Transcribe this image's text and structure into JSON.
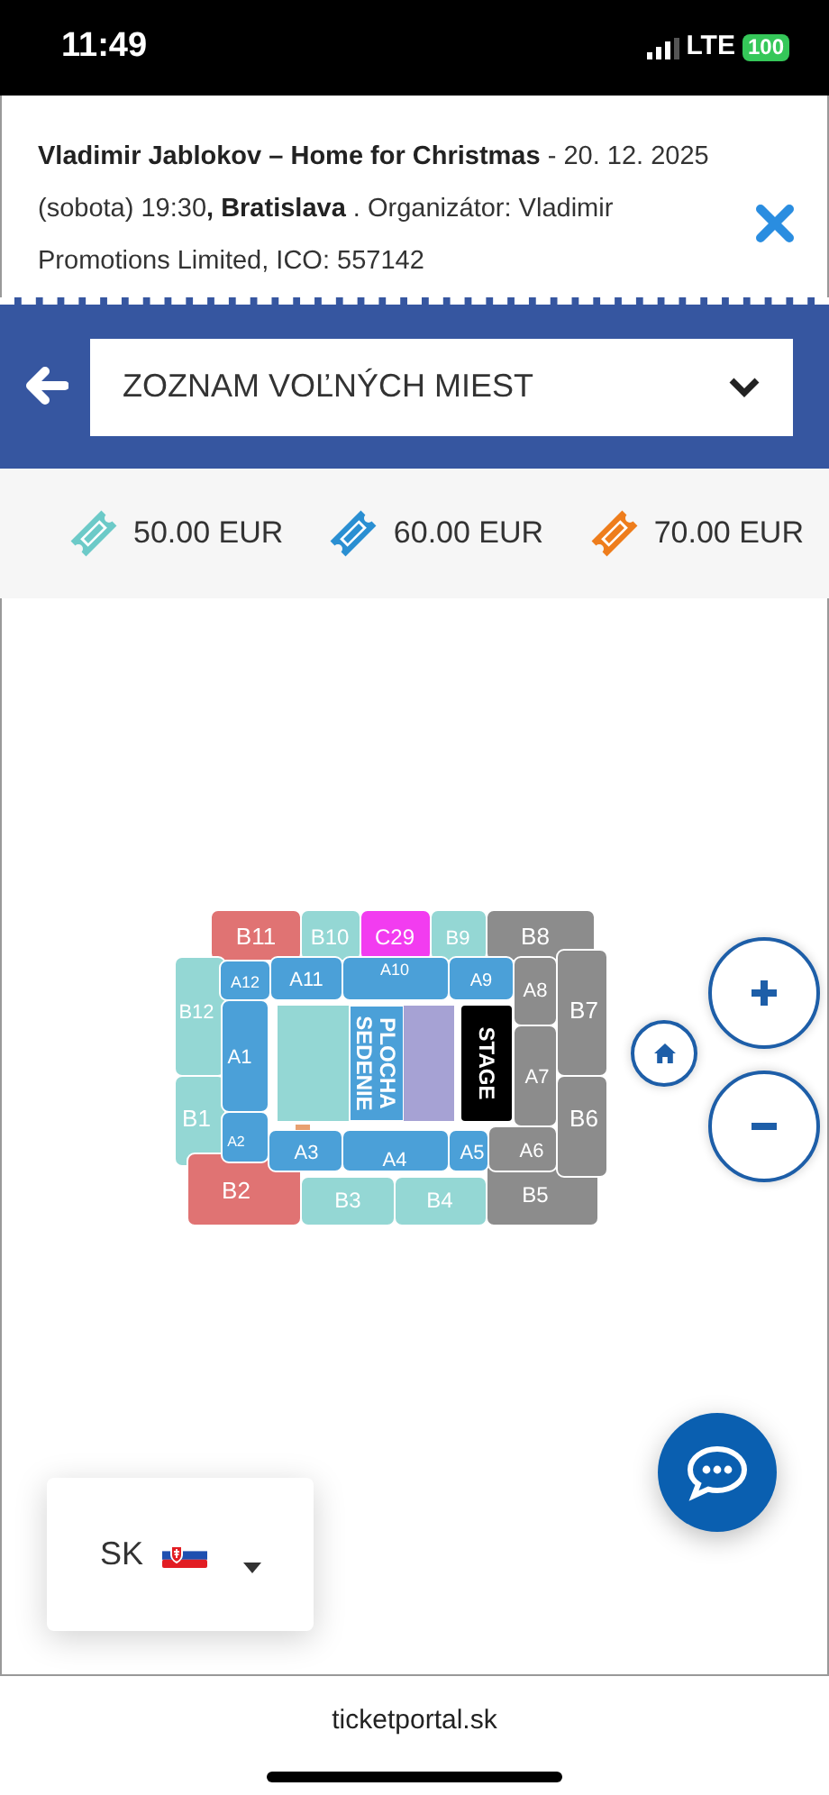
{
  "status_bar": {
    "time": "11:49",
    "network": "LTE",
    "battery": "100"
  },
  "event_header": {
    "text": "**Vladimir Jablokov – Home for Christmas** - 20. 12. 2025 (sobota) 19:30**, Bratislava** . Organizátor: Vladimir Promotions Limited, ICO: 557142"
  },
  "view_select": {
    "value": "ZOZNAM VOĽNÝCH MIEST"
  },
  "prices": [
    {
      "label": "50.00 EUR",
      "color": "#6ccac8"
    },
    {
      "label": "60.00 EUR",
      "color": "#2a8fd2"
    },
    {
      "label": "70.00 EUR",
      "color": "#ee7d1c"
    }
  ],
  "seat_map": {
    "sections": [
      {
        "label": "B11",
        "color": "#e07373"
      },
      {
        "label": "B10",
        "color": "#94d7d4"
      },
      {
        "label": "C29",
        "color": "#f23cf0"
      },
      {
        "label": "B9",
        "color": "#94d7d4"
      },
      {
        "label": "B8",
        "color": "#8c8c8c"
      },
      {
        "label": "B12",
        "color": "#94d7d4"
      },
      {
        "label": "B1",
        "color": "#94d7d4"
      },
      {
        "label": "B2",
        "color": "#e07373"
      },
      {
        "label": "B3",
        "color": "#94d7d4"
      },
      {
        "label": "B4",
        "color": "#94d7d4"
      },
      {
        "label": "B5",
        "color": "#8c8c8c"
      },
      {
        "label": "B7",
        "color": "#8c8c8c"
      },
      {
        "label": "B6",
        "color": "#8c8c8c"
      },
      {
        "label": "A12",
        "color": "#4ba0d8"
      },
      {
        "label": "A11",
        "color": "#4ba0d8"
      },
      {
        "label": "A10",
        "color": "#4ba0d8"
      },
      {
        "label": "A9",
        "color": "#4ba0d8"
      },
      {
        "label": "A8",
        "color": "#8c8c8c"
      },
      {
        "label": "A1",
        "color": "#4ba0d8"
      },
      {
        "label": "A2",
        "color": "#4ba0d8"
      },
      {
        "label": "A3",
        "color": "#4ba0d8"
      },
      {
        "label": "A4",
        "color": "#4ba0d8"
      },
      {
        "label": "A5",
        "color": "#4ba0d8"
      },
      {
        "label": "A7",
        "color": "#8c8c8c"
      },
      {
        "label": "A6",
        "color": "#8c8c8c"
      }
    ],
    "field": [
      {
        "kind": "standing",
        "color": "#94d7d4"
      },
      {
        "kind": "seating",
        "color": "#4ba0d8",
        "lines": [
          "PLOCHA",
          "SEDENIE"
        ]
      },
      {
        "kind": "standing",
        "color": "#a6a2d4"
      },
      {
        "kind": "stage",
        "color": "#000000",
        "lines": [
          "STAGE"
        ]
      }
    ]
  },
  "language": {
    "code": "SK"
  },
  "browser": {
    "url": "ticketportal.sk"
  }
}
